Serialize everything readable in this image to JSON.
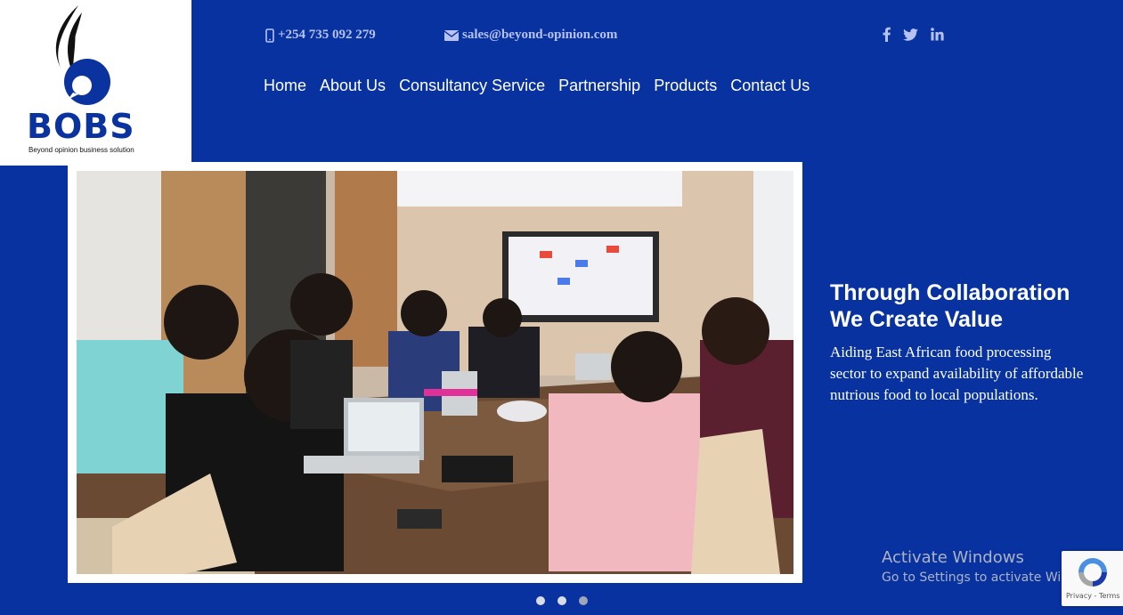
{
  "brand": {
    "name": "BOBS",
    "tagline": "Beyond opinion business solution",
    "primary_color": "#0732a0"
  },
  "contact": {
    "phone": "+254 735 092 279",
    "email": "sales@beyond-opinion.com",
    "phone_icon": "mobile-phone-icon",
    "email_icon": "envelope-icon"
  },
  "social": [
    "facebook-icon",
    "twitter-icon",
    "linkedin-icon"
  ],
  "nav": {
    "items": [
      "Home",
      "About Us",
      "Consultancy Service",
      "Partnership",
      "Products",
      "Contact Us"
    ]
  },
  "hero": {
    "title": "Through Collaboration We Create Value",
    "description": "Aiding East African food processing sector to expand availability of affordable nutrious food to local populations.",
    "active_slide": 1,
    "slide_count": 3
  },
  "watermark": {
    "title": "Activate Windows",
    "subtitle": "Go to Settings to activate Windows."
  },
  "recaptcha": {
    "links": "Privacy - Terms"
  }
}
